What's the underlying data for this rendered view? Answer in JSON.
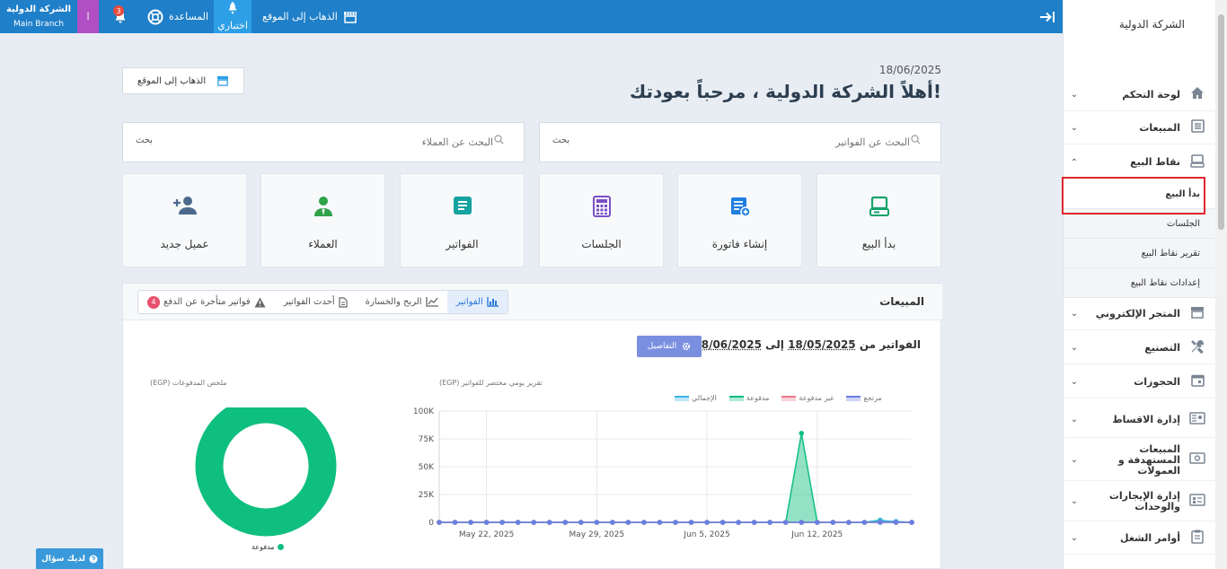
{
  "topbar": {
    "company_name": "الشركة الدولية",
    "branch": "Main Branch",
    "user_initial": "ا",
    "notifications_count": "3",
    "help_label": "المساعدة",
    "trial_label": "اختباري",
    "goto_site_label": "الذهاب إلى الموقع"
  },
  "sidebar": {
    "title": "الشركة الدولية",
    "items": [
      {
        "label": "لوحة التحكم"
      },
      {
        "label": "المبيعات"
      },
      {
        "label": "نقاط البيع"
      },
      {
        "label": "المتجر الإلكتروني"
      },
      {
        "label": "التصنيع"
      },
      {
        "label": "الحجوزات"
      },
      {
        "label": "إدارة الاقساط"
      },
      {
        "label": "المبيعات المستهدفة و العمولات"
      },
      {
        "label": "إدارة الإيجارات والوحدات"
      },
      {
        "label": "أوامر الشغل"
      }
    ],
    "pos_subitems": [
      "بدأ البيع",
      "الجلسات",
      "تقرير نقاط البيع",
      "إعدادات نقاط البيع"
    ]
  },
  "header": {
    "date": "18/06/2025",
    "welcome": "أهلاً الشركة الدولية ، مرحباً بعودتك!",
    "goto_site_label": "الذهاب إلى الموقع"
  },
  "search": {
    "invoices_placeholder": "البحث عن الفواتير",
    "customers_placeholder": "البحث عن العملاء",
    "button_label": "بحث"
  },
  "tiles": [
    {
      "label": "بدأ البيع",
      "icon": "pos-terminal-icon",
      "color": "#16a36b"
    },
    {
      "label": "إنشاء فاتورة",
      "icon": "add-invoice-icon",
      "color": "#1f7fe0"
    },
    {
      "label": "الجلسات",
      "icon": "calculator-icon",
      "color": "#7b4fc4"
    },
    {
      "label": "الفواتير",
      "icon": "document-icon",
      "color": "#15a3a0"
    },
    {
      "label": "العملاء",
      "icon": "user-tie-icon",
      "color": "#2fa24a"
    },
    {
      "label": "عميل جديد",
      "icon": "add-user-icon",
      "color": "#4b6a8c"
    }
  ],
  "sales": {
    "title": "المبيعات",
    "tabs": [
      {
        "label": "الفواتير"
      },
      {
        "label": "الربح والخسارة"
      },
      {
        "label": "أحدث الفواتير"
      },
      {
        "label": "فواتير متأخرة عن الدفع",
        "badge": "4"
      }
    ],
    "range_prefix": "الفواتير من",
    "range_from": "18/05/2025",
    "range_to_word": "إلى",
    "range_to": "18/06/2025",
    "details_label": "التفاصيل",
    "chart_title": "(EGP) تقرير يومي مختصر للفواتير",
    "donut_title": "(EGP) ملخص المدفوعات",
    "donut_legend": "مدفوعة"
  },
  "ask_label": "لديك سؤال",
  "colors": {
    "topbar": "#1f7fc8",
    "accent": "#2d7ad6",
    "paid": "#0fbf80",
    "unpaid": "#e87a8a",
    "refund": "#6b7fe0",
    "total": "#3ab5e8"
  },
  "chart_data": [
    {
      "type": "line",
      "title": "(EGP) تقرير يومي مختصر للفواتير",
      "x_labels": [
        "May 22, 2025",
        "May 29, 2025",
        "Jun 5, 2025",
        "Jun 12, 2025"
      ],
      "y_ticks": [
        "0",
        "25K",
        "50K",
        "75K",
        "100K"
      ],
      "ylim": [
        0,
        100000
      ],
      "grid": true,
      "legend": [
        "مرتجع",
        "غير مدفوعة",
        "مدفوعة",
        "الإجمالي"
      ],
      "legend_placement": "top-right",
      "x": [
        "2025-05-19",
        "2025-05-20",
        "2025-05-21",
        "2025-05-22",
        "2025-05-23",
        "2025-05-24",
        "2025-05-25",
        "2025-05-26",
        "2025-05-27",
        "2025-05-28",
        "2025-05-29",
        "2025-05-30",
        "2025-05-31",
        "2025-06-01",
        "2025-06-02",
        "2025-06-03",
        "2025-06-04",
        "2025-06-05",
        "2025-06-06",
        "2025-06-07",
        "2025-06-08",
        "2025-06-09",
        "2025-06-10",
        "2025-06-11",
        "2025-06-12",
        "2025-06-13",
        "2025-06-14",
        "2025-06-15",
        "2025-06-16",
        "2025-06-17",
        "2025-06-18"
      ],
      "series": [
        {
          "name": "مرتجع",
          "values": [
            0,
            0,
            0,
            0,
            0,
            0,
            0,
            0,
            0,
            0,
            0,
            0,
            0,
            0,
            0,
            0,
            0,
            0,
            0,
            0,
            0,
            0,
            0,
            0,
            0,
            0,
            0,
            0,
            0,
            0,
            0
          ]
        },
        {
          "name": "غير مدفوعة",
          "values": [
            0,
            0,
            0,
            0,
            0,
            0,
            0,
            0,
            0,
            0,
            0,
            0,
            0,
            0,
            0,
            0,
            0,
            0,
            0,
            0,
            0,
            0,
            0,
            0,
            0,
            0,
            0,
            0,
            0,
            0,
            0
          ]
        },
        {
          "name": "مدفوعة",
          "values": [
            0,
            0,
            0,
            0,
            0,
            0,
            0,
            0,
            0,
            0,
            0,
            0,
            0,
            0,
            0,
            0,
            0,
            0,
            0,
            0,
            0,
            0,
            0,
            80000,
            0,
            0,
            0,
            0,
            2000,
            0,
            0
          ]
        },
        {
          "name": "الإجمالي",
          "values": [
            0,
            0,
            0,
            0,
            0,
            0,
            0,
            0,
            0,
            0,
            0,
            0,
            0,
            0,
            0,
            0,
            0,
            0,
            0,
            0,
            0,
            0,
            0,
            0,
            0,
            0,
            0,
            0,
            1500,
            800,
            0
          ]
        }
      ]
    },
    {
      "type": "pie",
      "title": "(EGP) ملخص المدفوعات",
      "categories": [
        "مدفوعة"
      ],
      "values": [
        100
      ]
    }
  ]
}
